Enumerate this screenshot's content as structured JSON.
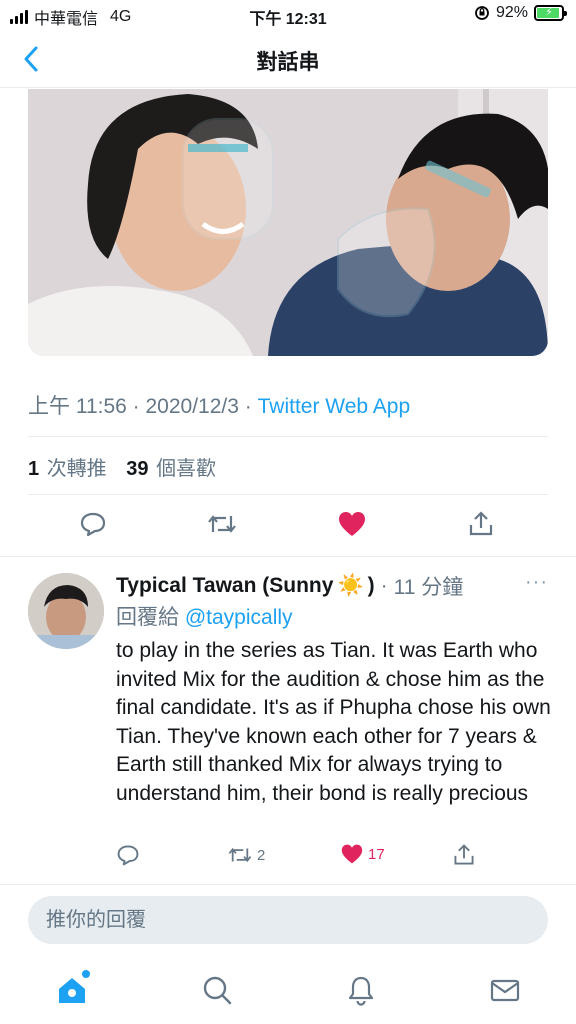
{
  "status_bar": {
    "carrier": "中華電信",
    "network": "4G",
    "time": "下午 12:31",
    "battery_percent": "92%",
    "battery_level": 0.92
  },
  "nav": {
    "title": "對話串",
    "back_icon": "chevron-left-icon"
  },
  "tweet": {
    "time": "上午 11:56",
    "sep1": " · ",
    "date": "2020/12/3",
    "sep2": " · ",
    "source": "Twitter Web App",
    "retweet_count": "1",
    "retweet_label": "次轉推",
    "like_count": "39",
    "like_label": "個喜歡",
    "liked": true
  },
  "reply": {
    "name": "Typical Tawan (Sunny",
    "name_end": ")",
    "emoji": "☀️",
    "sep": "·",
    "time": "11 分鐘",
    "more": "···",
    "reply_to_label": "回覆給",
    "reply_to_handle": "@taypically",
    "text": "to play in the series as Tian. It was Earth who invited Mix for the audition & chose him as the final candidate. It's as if Phupha chose his own Tian. They've known each other for 7 years & Earth still thanked Mix for always trying to understand him, their bond is really precious",
    "retweets": "2",
    "likes": "17"
  },
  "compose": {
    "placeholder": "推你的回覆"
  },
  "tabs": [
    "home-icon",
    "search-icon",
    "bell-icon",
    "mail-icon"
  ],
  "colors": {
    "accent": "#1da1f2",
    "like": "#e0245e",
    "muted": "#657786",
    "battery": "#4cd964"
  }
}
